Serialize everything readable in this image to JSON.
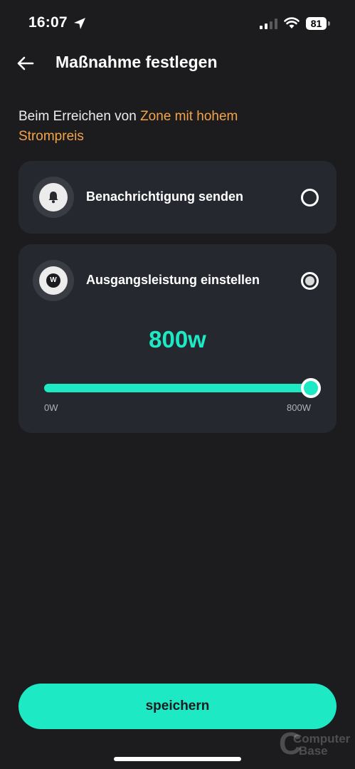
{
  "status_bar": {
    "time": "16:07",
    "battery": "81"
  },
  "header": {
    "title": "Maßnahme festlegen"
  },
  "subtitle": {
    "prefix": "Beim Erreichen von ",
    "highlight": "Zone mit hohem Strompreis"
  },
  "options": [
    {
      "label": "Benachrichtigung senden",
      "icon": "bell-icon",
      "selected": false
    },
    {
      "label": "Ausgangsleistung einstellen",
      "icon": "w-icon",
      "icon_text": "W",
      "selected": true
    }
  ],
  "power": {
    "value": "800w",
    "slider_fraction": 1.0,
    "min_label": "0W",
    "max_label": "800W"
  },
  "save_label": "speichern",
  "watermark": {
    "line1": "Computer",
    "line2": "Base"
  },
  "colors": {
    "accent": "#1de9c5",
    "highlight": "#f3a34a",
    "background": "#1c1c1e",
    "card": "#262830"
  }
}
